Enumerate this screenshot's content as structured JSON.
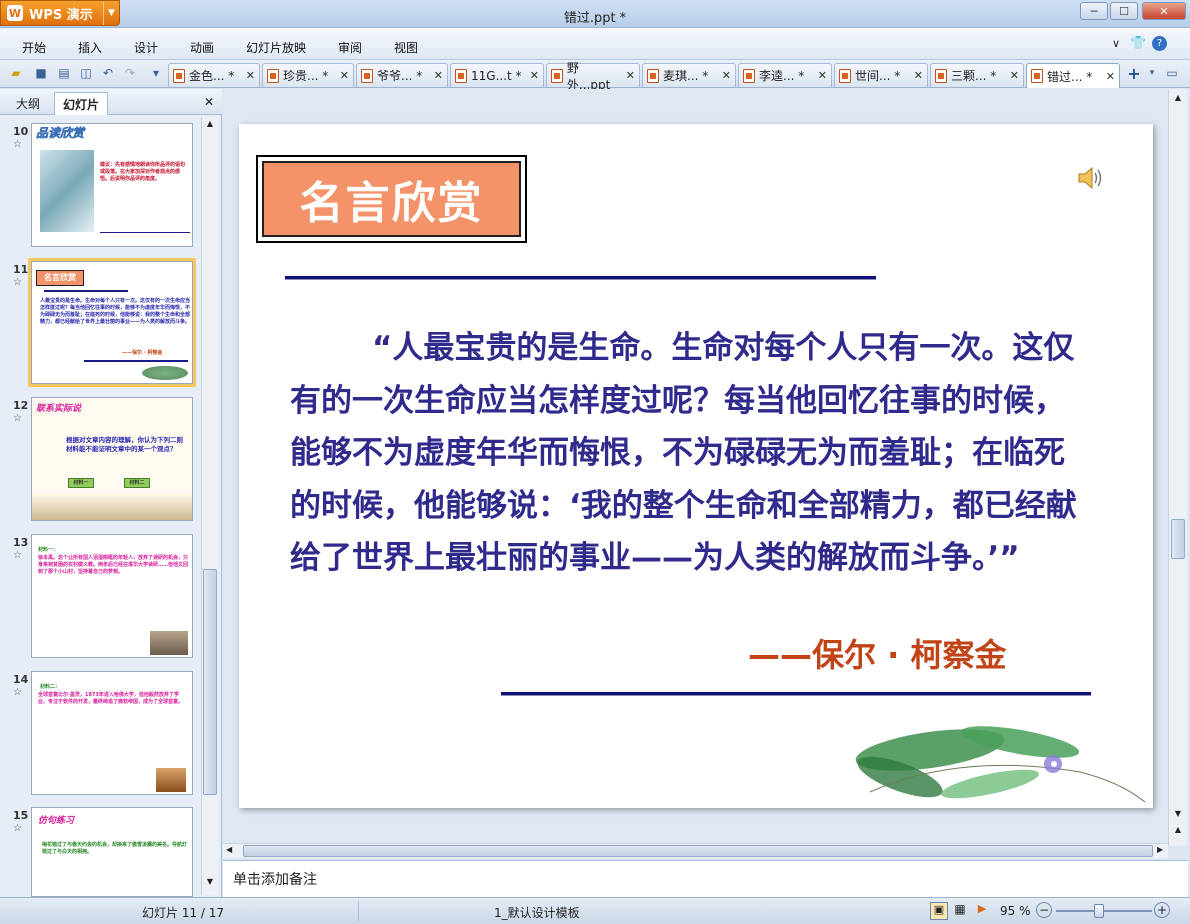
{
  "app": {
    "button_label": "WPS 演示",
    "doc_title": "错过.ppt *"
  },
  "menu": [
    "开始",
    "插入",
    "设计",
    "动画",
    "幻灯片放映",
    "审阅",
    "视图"
  ],
  "doc_tabs": [
    "金色... *",
    "珍贵... *",
    "爷爷... *",
    "11G...t *",
    "野外...ppt",
    "麦琪... *",
    "李逵... *",
    "世间... *",
    "三颗... *",
    "错过... *"
  ],
  "panel": {
    "tab_outline": "大纲",
    "tab_slides": "幻灯片"
  },
  "thumbnails": [
    {
      "num": "10",
      "title": "品读欣赏",
      "text": "建议：先有感情地朗读你所品评的语句或段落。在大家加深对作者观点的感悟。后说明你品评的角度。"
    },
    {
      "num": "11",
      "title": "名言欣赏",
      "text": "人最宝贵的是生命。生命对每个人只有一次。这仅有的一次生命应当怎样度过呢？每当他回忆往事的时候，能够不为虚度年华而悔恨，不为碌碌无为而羞耻；在临死的时候，他能够说：我的整个生命和全部精力，都已经献给了世界上最壮丽的事业——为人类的解放而斗争。",
      "author": "——保尔 · 柯察金"
    },
    {
      "num": "12",
      "title": "联系实际说",
      "text": "根据对文章内容的理解，你认为下列二则材料能不能证明文章中的某一个观点？",
      "btn1": "材料一",
      "btn2": "材料二"
    },
    {
      "num": "13",
      "title": "材料一：",
      "text": "徐本禹。这个让所有国人泪湿眼眶的年轻人，放弃了读研的机会，只身来到贫困的农村做义教。两年后已经在清华大学读研……但他又回到了那个小山村，坚持着自己的梦想。"
    },
    {
      "num": "14",
      "title": "材料二：",
      "text": "全球首富比尔·盖茨，1973年进入哈佛大学，但他毅然放弃了学业，专注于软件的开发，最终缔造了微软帝国，成为了全球首富。"
    },
    {
      "num": "15",
      "title": "仿句练习",
      "text": "梅花错过了与春天约会的机会，却换来了傲雪凌霜的美名。导航灯错过了与白天的相拥。"
    }
  ],
  "slide": {
    "title": "名言欣赏",
    "quote": "“人最宝贵的是生命。生命对每个人只有一次。这仅有的一次生命应当怎样度过呢？每当他回忆往事的时候，能够不为虚度年华而悔恨，不为碌碌无为而羞耻；在临死的时候，他能够说：‘我的整个生命和全部精力，都已经献给了世界上最壮丽的事业——为人类的解放而斗争。’”",
    "author": "——保尔 · 柯察金"
  },
  "notes_placeholder": "单击添加备注",
  "status": {
    "slide_count": "幻灯片 11 / 17",
    "template": "1_默认设计模板",
    "zoom": "95 %"
  }
}
